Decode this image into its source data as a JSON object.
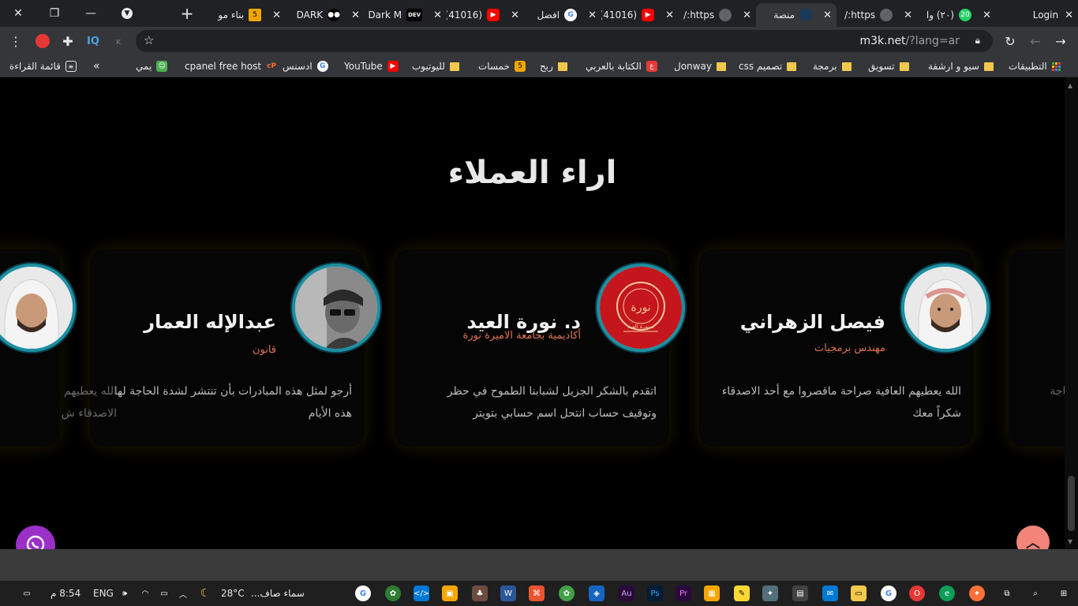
{
  "browser": {
    "tabs": [
      {
        "label": "Login"
      },
      {
        "label": "(٢٠) وا"
      },
      {
        "label": "https:/"
      },
      {
        "label": "منصة"
      },
      {
        "label": "https:/"
      },
      {
        "label": "(41016)"
      },
      {
        "label": "افضل"
      },
      {
        "label": "(41016)"
      },
      {
        "label": "Dark M"
      },
      {
        "label": "DARK"
      },
      {
        "label": "بناء مو"
      }
    ],
    "whatsapp_badge": "20",
    "url_host": "m3k.net",
    "url_path": "/?lang=ar",
    "extension_iq": "IQ"
  },
  "bookmarks": {
    "apps": "التطبيقات",
    "items": [
      "سيو و ارشفة",
      "تسويق",
      "برمجة",
      "تصميم css",
      "onwayل",
      "الكتابة بالعربي",
      "ربح",
      "خمسات",
      "لليوتيوب",
      "YouTube",
      "ادسنس",
      "cpanel free host",
      "يمي"
    ],
    "reading_list": "قائمة القراءة",
    "overflow": "»"
  },
  "section": {
    "title": "اراء العملاء"
  },
  "testimonials": [
    {
      "name": "فيصل الزهراني",
      "role": "مهندس برمجيات",
      "text": "الله يعطيهم العافية صراحة ماقصروا مع أحد الاصدقاء شكراً معك"
    },
    {
      "name": "د. نورة العيد",
      "role": "أكاديمية بجامعة الاميرة نورة",
      "text": "اتقدم بالشكر الجزيل لشبابنا الطموح في حظر وتوقيف حساب انتحل اسم حسابي بتويتر"
    },
    {
      "name": "عبدالإله العمار",
      "role": "قانون",
      "text": "أرجو لمثل هذه المبادرات بأن تنتشر لشدة الحاجة لها هذه الأيام"
    }
  ],
  "partial_left_text": "الله يعطيهم\nالاصدقاء ش",
  "partial_right_text": "الحاجة",
  "avatar_logo_text": "د.نورة العيد",
  "taskbar": {
    "time": "8:54 م",
    "lang": "ENG",
    "temp": "28°C",
    "weather": "سماء صاف..."
  },
  "colors": {
    "accent": "#e0734e",
    "ring": "#1c8fa2",
    "whatsapp": "#9b30c8",
    "scroll_top": "#f2847a"
  }
}
